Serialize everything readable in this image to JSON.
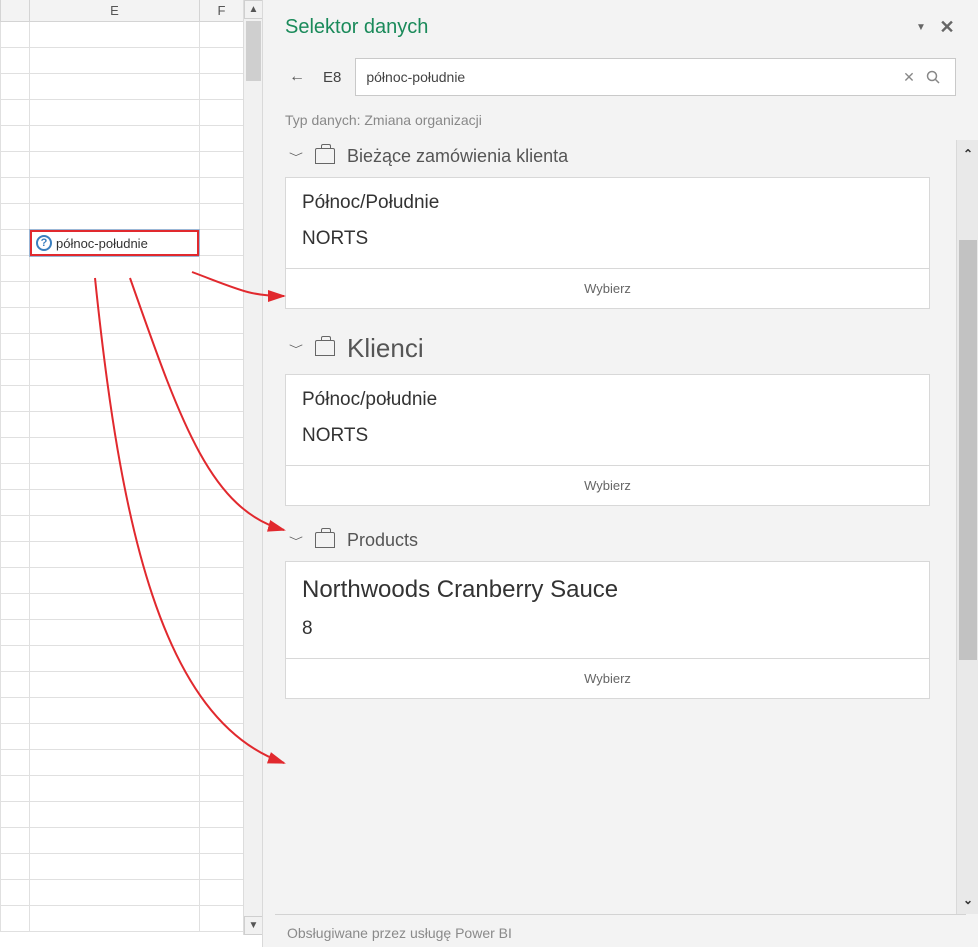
{
  "grid": {
    "columns": [
      "E",
      "F"
    ],
    "active_cell_text": "północ-południe"
  },
  "panel": {
    "title": "Selektor danych",
    "cell_ref": "E8",
    "search_value": "północ-południe",
    "type_line": "Typ danych: Zmiana organizacji",
    "footer": "Obsługiwane przez usługę Power BI"
  },
  "groups": [
    {
      "title": "Bieżące zamówienia klienta",
      "big": false,
      "card": {
        "line1": "Północ/Południe",
        "line2": "NORTS",
        "select": "Wybierz",
        "big": false
      }
    },
    {
      "title": "Klienci",
      "big": true,
      "card": {
        "line1": "Północ/południe",
        "line2": "NORTS",
        "select": "Wybierz",
        "big": false
      }
    },
    {
      "title": "Products",
      "big": false,
      "card": {
        "line1": "Northwoods Cranberry Sauce",
        "line2": "8",
        "select": "Wybierz",
        "big": true
      }
    }
  ]
}
